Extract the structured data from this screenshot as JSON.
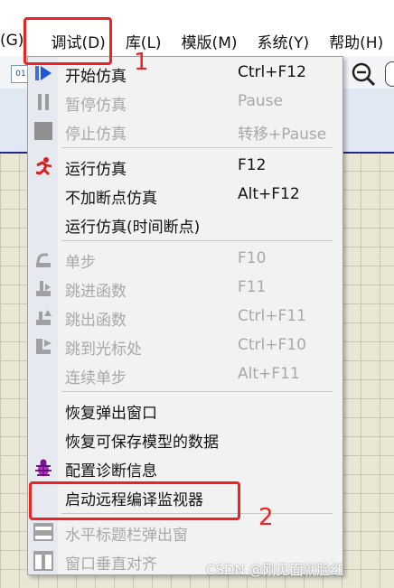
{
  "menubar": {
    "items": [
      {
        "label": "(G)"
      },
      {
        "label": "调试(D)"
      },
      {
        "label": "库(L)"
      },
      {
        "label": "模版(M)"
      },
      {
        "label": "系统(Y)"
      },
      {
        "label": "帮助(H)"
      }
    ]
  },
  "menu": {
    "items": [
      {
        "label": "开始仿真",
        "shortcut": "Ctrl+F12",
        "enabled": true,
        "icon": "play-icon"
      },
      {
        "label": "暂停仿真",
        "shortcut": "Pause",
        "enabled": false,
        "icon": "pause-icon"
      },
      {
        "label": "停止仿真",
        "shortcut": "转移+Pause",
        "enabled": false,
        "icon": "stop-icon"
      },
      {
        "label": "运行仿真",
        "shortcut": "F12",
        "enabled": true,
        "icon": "run-icon"
      },
      {
        "label": "不加断点仿真",
        "shortcut": "Alt+F12",
        "enabled": true,
        "icon": ""
      },
      {
        "label": "运行仿真(时间断点)",
        "shortcut": "",
        "enabled": true,
        "icon": ""
      },
      {
        "label": "单步",
        "shortcut": "F10",
        "enabled": false,
        "icon": "step-icon"
      },
      {
        "label": "跳进函数",
        "shortcut": "F11",
        "enabled": false,
        "icon": "step-into-icon"
      },
      {
        "label": "跳出函数",
        "shortcut": "Ctrl+F11",
        "enabled": false,
        "icon": "step-out-icon"
      },
      {
        "label": "跳到光标处",
        "shortcut": "Ctrl+F10",
        "enabled": false,
        "icon": "run-to-cursor-icon"
      },
      {
        "label": "连续单步",
        "shortcut": "Alt+F11",
        "enabled": false,
        "icon": ""
      },
      {
        "label": "恢复弹出窗口",
        "shortcut": "",
        "enabled": true,
        "icon": ""
      },
      {
        "label": "恢复可保存模型的数据",
        "shortcut": "",
        "enabled": true,
        "icon": ""
      },
      {
        "label": "配置诊断信息",
        "shortcut": "",
        "enabled": true,
        "icon": "bug-icon"
      },
      {
        "label": "启动远程编译监视器",
        "shortcut": "",
        "enabled": true,
        "icon": ""
      },
      {
        "label": "水平标题栏弹出窗",
        "shortcut": "",
        "enabled": false,
        "icon": "horizontal-tile-icon"
      },
      {
        "label": "窗口垂直对齐",
        "shortcut": "",
        "enabled": false,
        "icon": "vertical-tile-icon"
      }
    ]
  },
  "annotations": {
    "label_1": "1",
    "label_2": "2",
    "color": "#ee2222"
  },
  "watermark": "CSDN @刚见面就脸红"
}
